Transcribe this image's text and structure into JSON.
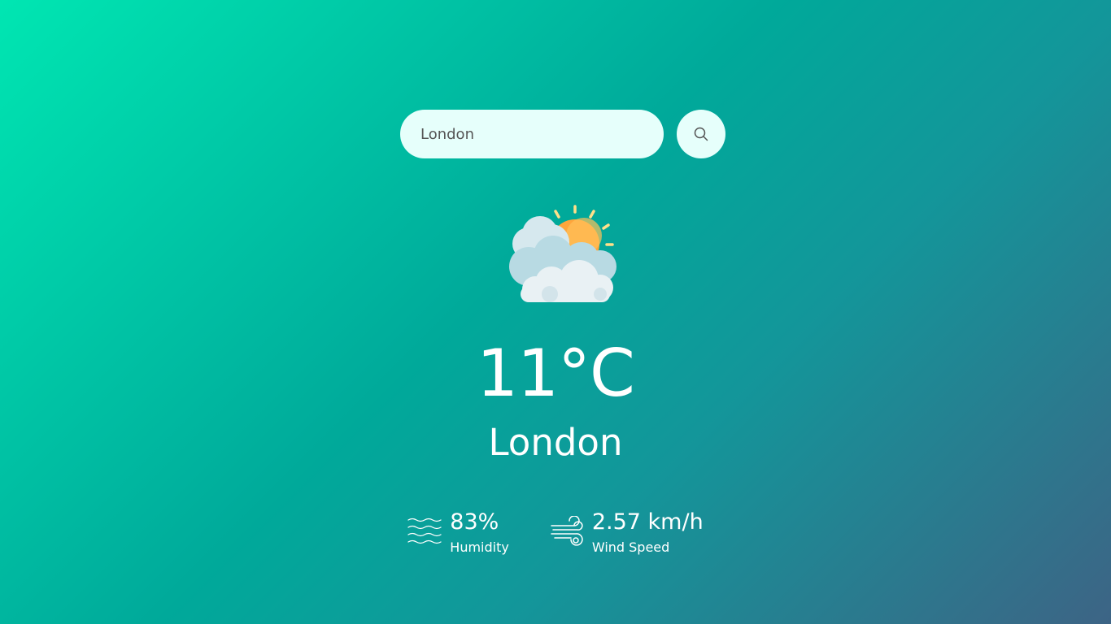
{
  "search": {
    "value": "London",
    "button_icon": "search-icon"
  },
  "weather": {
    "icon": "partly-cloudy-sun-icon",
    "temperature": "11°C",
    "city": "London"
  },
  "details": {
    "humidity": {
      "value": "83%",
      "label": "Humidity",
      "icon": "humidity-waves-icon"
    },
    "wind": {
      "value": "2.57 km/h",
      "label": "Wind Speed",
      "icon": "wind-icon"
    }
  },
  "colors": {
    "gradient_start": "#00e6b2",
    "gradient_end": "#3d6485",
    "input_bg": "#e6fffb",
    "sun": "#ffa63c",
    "cloud": "#eaf3f6"
  }
}
